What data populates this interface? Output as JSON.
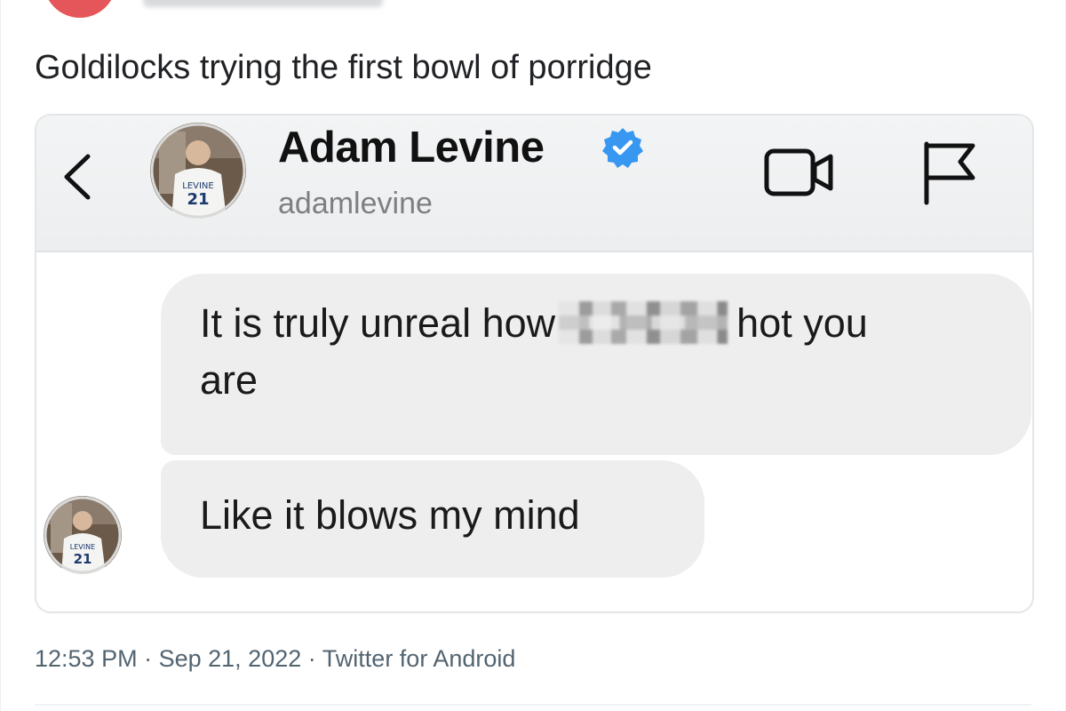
{
  "tweet": {
    "text": "Goldilocks trying the first bowl of porridge",
    "time": "12:53 PM",
    "separator": "·",
    "date": "Sep 21, 2022",
    "source": "Twitter for Android"
  },
  "dm": {
    "contact_name": "Adam Levine",
    "contact_handle": "adamlevine",
    "verified": true,
    "messages": [
      {
        "line1_before": "It is truly unreal how",
        "redacted": true,
        "line1_after": "hot you",
        "line2": "are"
      },
      {
        "text": "Like it blows my mind"
      }
    ]
  },
  "icons": {
    "back": "chevron-left-icon",
    "video": "video-camera-icon",
    "flag": "flag-icon",
    "verified": "verified-badge-icon"
  },
  "colors": {
    "verified_blue": "#3897f0",
    "bubble_gray": "#eeeeee",
    "meta_gray": "#536471",
    "handle_gray": "#7d7f82"
  }
}
